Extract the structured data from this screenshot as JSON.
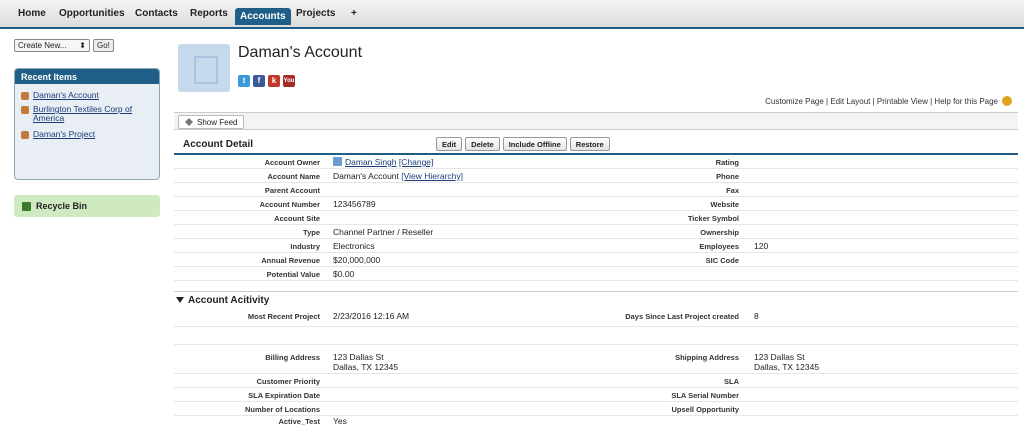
{
  "nav": {
    "tabs": [
      "Home",
      "Opportunities",
      "Contacts",
      "Reports",
      "Accounts",
      "Projects",
      "+"
    ]
  },
  "sidebar": {
    "create_new": "Create New...",
    "go": "Go!",
    "recent_header": "Recent Items",
    "recent_items": [
      "Daman's Account",
      "Burlington Textiles Corp of America",
      "Daman's Project"
    ],
    "recycle_bin": "Recycle Bin"
  },
  "header": {
    "title": "Daman's Account",
    "links": "Customize Page | Edit Layout | Printable View | Help for this Page",
    "social": [
      "twitter-icon",
      "facebook-icon",
      "klout-icon",
      "youtube-icon"
    ]
  },
  "feed": {
    "show_feed": "Show Feed"
  },
  "detail": {
    "title": "Account Detail",
    "buttons": [
      "Edit",
      "Delete",
      "Include Offline",
      "Restore"
    ],
    "left": [
      {
        "label": "Account Owner",
        "value": "Daman Singh",
        "link": "[Change]"
      },
      {
        "label": "Account Name",
        "value": "Daman's Account",
        "link": "[View Hierarchy]"
      },
      {
        "label": "Parent Account",
        "value": ""
      },
      {
        "label": "Account Number",
        "value": "123456789"
      },
      {
        "label": "Account Site",
        "value": ""
      },
      {
        "label": "Type",
        "value": "Channel Partner / Reseller"
      },
      {
        "label": "Industry",
        "value": "Electronics"
      },
      {
        "label": "Annual Revenue",
        "value": "$20,000,000"
      },
      {
        "label": "Potential Value",
        "value": "$0.00"
      }
    ],
    "right": [
      {
        "label": "Rating",
        "value": ""
      },
      {
        "label": "Phone",
        "value": ""
      },
      {
        "label": "Fax",
        "value": ""
      },
      {
        "label": "Website",
        "value": ""
      },
      {
        "label": "Ticker Symbol",
        "value": ""
      },
      {
        "label": "Ownership",
        "value": ""
      },
      {
        "label": "Employees",
        "value": "120"
      },
      {
        "label": "SIC Code",
        "value": ""
      }
    ]
  },
  "activity": {
    "title": "Account Acitivity",
    "most_recent_label": "Most Recent Project",
    "most_recent_value": "2/23/2016 12:16 AM",
    "days_since_label": "Days Since Last Project created",
    "days_since_value": "8",
    "billing_label": "Billing Address",
    "billing_line1": "123 Dallas St",
    "billing_line2": "Dallas, TX 12345",
    "shipping_label": "Shipping Address",
    "shipping_line1": "123 Dallas St",
    "shipping_line2": "Dallas, TX 12345",
    "customer_priority_label": "Customer Priority",
    "sla_label": "SLA",
    "sla_expiration_label": "SLA Expiration Date",
    "sla_serial_label": "SLA Serial Number",
    "num_locations_label": "Number of Locations",
    "upsell_label": "Upsell Opportunity",
    "active_test_label": "Active_Test",
    "active_test_value": "Yes"
  }
}
